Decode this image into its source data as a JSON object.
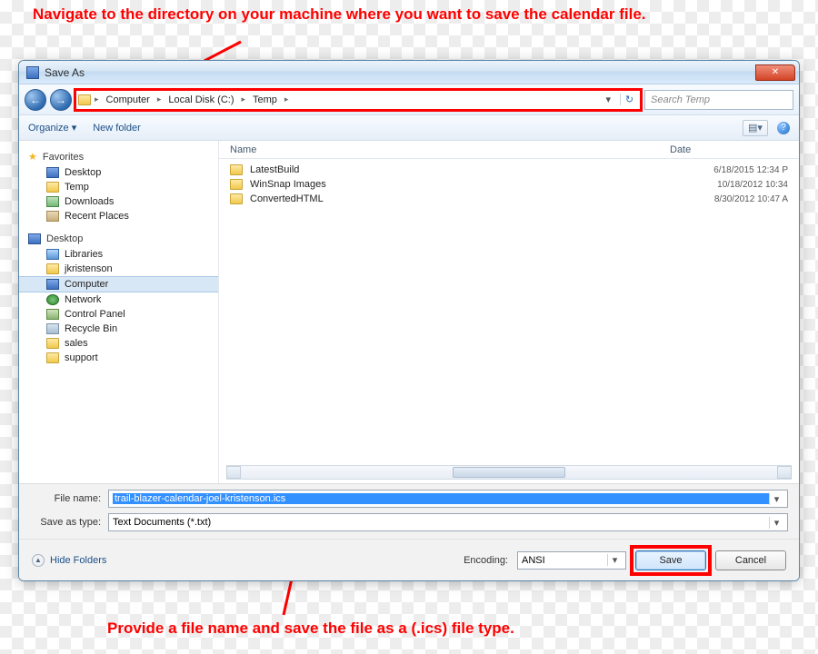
{
  "callouts": {
    "top": "Navigate to the directory on your machine where you want to save the calendar file.",
    "bottom": "Provide a file name and save the file as a (.ics) file type."
  },
  "titlebar": {
    "title": "Save As",
    "close_glyph": "✕"
  },
  "nav": {
    "back_glyph": "←",
    "fwd_glyph": "→",
    "breadcrumb": [
      "Computer",
      "Local Disk (C:)",
      "Temp"
    ],
    "refresh_glyph": "↻",
    "search_placeholder": "Search Temp"
  },
  "toolbar": {
    "organize": "Organize ▾",
    "newfolder": "New folder",
    "view_glyph": "▤▾",
    "help_glyph": "?"
  },
  "sidebar": {
    "favorites_label": "Favorites",
    "favorites": [
      "Desktop",
      "Temp",
      "Downloads",
      "Recent Places"
    ],
    "desktop_label": "Desktop",
    "desktop_items": [
      "Libraries",
      "jkristenson",
      "Computer",
      "Network",
      "Control Panel",
      "Recycle Bin",
      "sales",
      "support"
    ],
    "selected": "Computer"
  },
  "filelist": {
    "col_name": "Name",
    "col_date": "Date",
    "rows": [
      {
        "name": "LatestBuild",
        "date": "6/18/2015 12:34 P"
      },
      {
        "name": "WinSnap Images",
        "date": "10/18/2012 10:34"
      },
      {
        "name": "ConvertedHTML",
        "date": "8/30/2012 10:47 A"
      }
    ],
    "scroll_marker": "III"
  },
  "fields": {
    "filename_label": "File name:",
    "filename_value": "trail-blazer-calendar-joel-kristenson.ics",
    "type_label": "Save as type:",
    "type_value": "Text Documents (*.txt)"
  },
  "actions": {
    "hide_label": "Hide Folders",
    "encoding_label": "Encoding:",
    "encoding_value": "ANSI",
    "save": "Save",
    "cancel": "Cancel"
  }
}
